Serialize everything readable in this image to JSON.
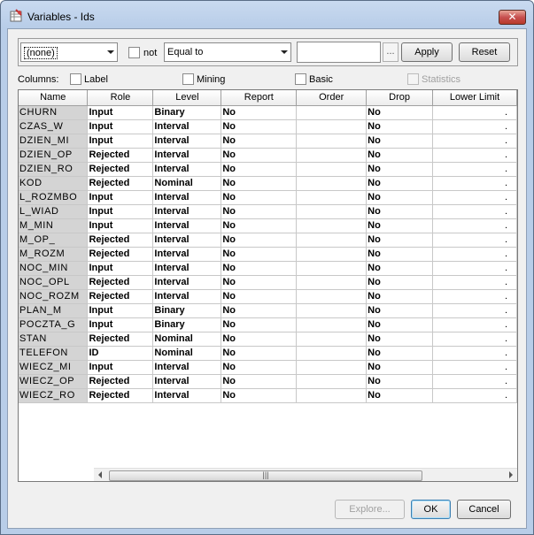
{
  "window": {
    "title": "Variables - Ids",
    "close_glyph": "✕"
  },
  "filter": {
    "field_value": "(none)",
    "not_label": "not",
    "operator_value": "Equal to",
    "value_input": "",
    "ellipsis_label": "...",
    "apply_label": "Apply",
    "reset_label": "Reset"
  },
  "columns_bar": {
    "label": "Columns:",
    "options": [
      {
        "label": "Label",
        "checked": false,
        "enabled": true
      },
      {
        "label": "Mining",
        "checked": false,
        "enabled": true
      },
      {
        "label": "Basic",
        "checked": false,
        "enabled": true
      },
      {
        "label": "Statistics",
        "checked": false,
        "enabled": false
      }
    ]
  },
  "table": {
    "headers": [
      "Name",
      "Role",
      "Level",
      "Report",
      "Order",
      "Drop",
      "Lower Limit"
    ],
    "rows": [
      {
        "name": "CHURN",
        "role": "Input",
        "level": "Binary",
        "report": "No",
        "order": "",
        "drop": "No",
        "lower": "."
      },
      {
        "name": "CZAS_W",
        "role": "Input",
        "level": "Interval",
        "report": "No",
        "order": "",
        "drop": "No",
        "lower": "."
      },
      {
        "name": "DZIEN_MI",
        "role": "Input",
        "level": "Interval",
        "report": "No",
        "order": "",
        "drop": "No",
        "lower": "."
      },
      {
        "name": "DZIEN_OP",
        "role": "Rejected",
        "level": "Interval",
        "report": "No",
        "order": "",
        "drop": "No",
        "lower": "."
      },
      {
        "name": "DZIEN_RO",
        "role": "Rejected",
        "level": "Interval",
        "report": "No",
        "order": "",
        "drop": "No",
        "lower": "."
      },
      {
        "name": "KOD",
        "role": "Rejected",
        "level": "Nominal",
        "report": "No",
        "order": "",
        "drop": "No",
        "lower": "."
      },
      {
        "name": "L_ROZMBO",
        "role": "Input",
        "level": "Interval",
        "report": "No",
        "order": "",
        "drop": "No",
        "lower": "."
      },
      {
        "name": "L_WIAD",
        "role": "Input",
        "level": "Interval",
        "report": "No",
        "order": "",
        "drop": "No",
        "lower": "."
      },
      {
        "name": "M_MIN",
        "role": "Input",
        "level": "Interval",
        "report": "No",
        "order": "",
        "drop": "No",
        "lower": "."
      },
      {
        "name": "M_OP_",
        "role": "Rejected",
        "level": "Interval",
        "report": "No",
        "order": "",
        "drop": "No",
        "lower": "."
      },
      {
        "name": "M_ROZM",
        "role": "Rejected",
        "level": "Interval",
        "report": "No",
        "order": "",
        "drop": "No",
        "lower": "."
      },
      {
        "name": "NOC_MIN",
        "role": "Input",
        "level": "Interval",
        "report": "No",
        "order": "",
        "drop": "No",
        "lower": "."
      },
      {
        "name": "NOC_OPL",
        "role": "Rejected",
        "level": "Interval",
        "report": "No",
        "order": "",
        "drop": "No",
        "lower": "."
      },
      {
        "name": "NOC_ROZM",
        "role": "Rejected",
        "level": "Interval",
        "report": "No",
        "order": "",
        "drop": "No",
        "lower": "."
      },
      {
        "name": "PLAN_M",
        "role": "Input",
        "level": "Binary",
        "report": "No",
        "order": "",
        "drop": "No",
        "lower": "."
      },
      {
        "name": "POCZTA_G",
        "role": "Input",
        "level": "Binary",
        "report": "No",
        "order": "",
        "drop": "No",
        "lower": "."
      },
      {
        "name": "STAN",
        "role": "Rejected",
        "level": "Nominal",
        "report": "No",
        "order": "",
        "drop": "No",
        "lower": "."
      },
      {
        "name": "TELEFON",
        "role": "ID",
        "level": "Nominal",
        "report": "No",
        "order": "",
        "drop": "No",
        "lower": "."
      },
      {
        "name": "WIECZ_MI",
        "role": "Input",
        "level": "Interval",
        "report": "No",
        "order": "",
        "drop": "No",
        "lower": "."
      },
      {
        "name": "WIECZ_OP",
        "role": "Rejected",
        "level": "Interval",
        "report": "No",
        "order": "",
        "drop": "No",
        "lower": "."
      },
      {
        "name": "WIECZ_RO",
        "role": "Rejected",
        "level": "Interval",
        "report": "No",
        "order": "",
        "drop": "No",
        "lower": "."
      }
    ]
  },
  "scrollbar": {
    "thumb_grip": "|||"
  },
  "footer": {
    "explore_label": "Explore...",
    "ok_label": "OK",
    "cancel_label": "Cancel"
  }
}
